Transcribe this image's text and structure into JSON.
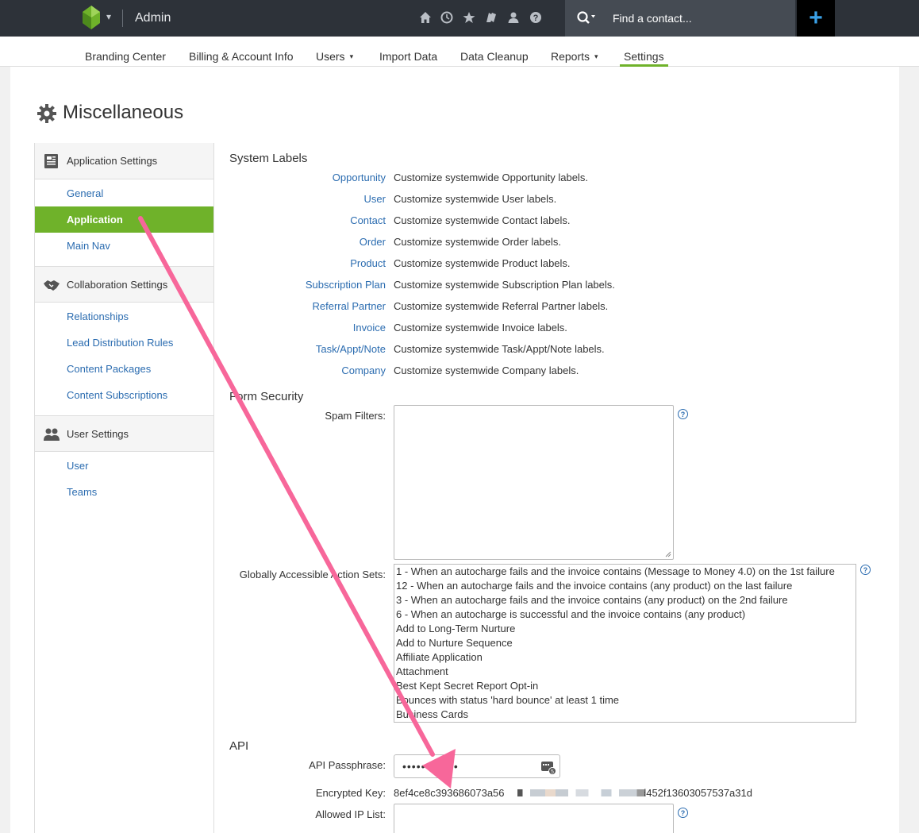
{
  "topbar": {
    "title": "Admin",
    "search_placeholder": "Find a contact...",
    "icons": [
      "home-icon",
      "clock-icon",
      "star-icon",
      "flag-icon",
      "person-icon",
      "help-icon"
    ]
  },
  "nav": {
    "items": [
      {
        "label": "Branding Center"
      },
      {
        "label": "Billing & Account Info"
      },
      {
        "label": "Users"
      },
      {
        "label": "Import Data"
      },
      {
        "label": "Data Cleanup"
      },
      {
        "label": "Reports"
      },
      {
        "label": "Settings"
      }
    ],
    "active": "Settings"
  },
  "page": {
    "title": "Miscellaneous"
  },
  "sidebar": {
    "sections": [
      {
        "label": "Application Settings",
        "links": [
          "General",
          "Application",
          "Main Nav"
        ]
      },
      {
        "label": "Collaboration Settings",
        "links": [
          "Relationships",
          "Lead Distribution Rules",
          "Content Packages",
          "Content Subscriptions"
        ]
      },
      {
        "label": "User Settings",
        "links": [
          "User",
          "Teams"
        ]
      }
    ],
    "active_link": "Application"
  },
  "system_labels": {
    "heading": "System Labels",
    "rows": [
      {
        "name": "Opportunity",
        "desc": "Customize systemwide Opportunity labels."
      },
      {
        "name": "User",
        "desc": "Customize systemwide User labels."
      },
      {
        "name": "Contact",
        "desc": "Customize systemwide Contact labels."
      },
      {
        "name": "Order",
        "desc": "Customize systemwide Order labels."
      },
      {
        "name": "Product",
        "desc": "Customize systemwide Product labels."
      },
      {
        "name": "Subscription Plan",
        "desc": "Customize systemwide Subscription Plan labels."
      },
      {
        "name": "Referral Partner",
        "desc": "Customize systemwide Referral Partner labels."
      },
      {
        "name": "Invoice",
        "desc": "Customize systemwide Invoice labels."
      },
      {
        "name": "Task/Appt/Note",
        "desc": "Customize systemwide Task/Appt/Note labels."
      },
      {
        "name": "Company",
        "desc": "Customize systemwide Company labels."
      }
    ]
  },
  "form_security": {
    "heading": "Form Security",
    "spam_label": "Spam Filters:",
    "spam_value": "",
    "action_sets_label": "Globally Accessible Action Sets:",
    "action_sets": [
      "1 - When an autocharge fails and the invoice contains (Message to Money 4.0) on the 1st failure",
      "12 - When an autocharge fails and the invoice contains (any product) on the last failure",
      "3 - When an autocharge fails and the invoice contains (any product) on the 2nd failure",
      "6 - When an autocharge is successful and the invoice contains (any product)",
      "Add to Long-Term Nurture",
      "Add to Nurture Sequence",
      "Affiliate Application",
      "Attachment",
      "Best Kept Secret Report Opt-in",
      "Bounces with status 'hard bounce' at least 1 time",
      "Business Cards"
    ]
  },
  "api": {
    "heading": "API",
    "passphrase_label": "API Passphrase:",
    "passphrase_value": "••••••••••••",
    "encrypted_key_label": "Encrypted Key:",
    "encrypted_key_prefix": "8ef4ce8c393686073a56",
    "encrypted_key_suffix": "a4d452f13603057537a31d",
    "allowed_ip_label": "Allowed IP List:",
    "allowed_ip_value": ""
  },
  "colors": {
    "topbar": "#2d3239",
    "accent_green": "#6fb22a",
    "link_blue": "#2b6cb0",
    "annotation_arrow": "#f7679a"
  }
}
